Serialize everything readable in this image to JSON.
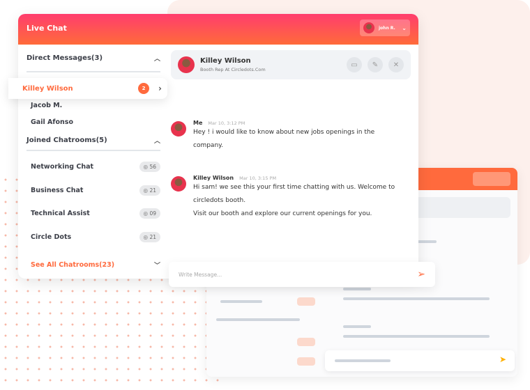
{
  "app": {
    "title": "Live Chat",
    "user": "john R."
  },
  "sidebar": {
    "direct_title": "Direct Messages(3)",
    "direct": [
      {
        "name": "Killey Wilson",
        "badge": "2"
      },
      {
        "name": "Jacob M."
      },
      {
        "name": "Gail Afonso"
      }
    ],
    "rooms_title": "Joined Chatrooms(5)",
    "rooms": [
      {
        "name": "Networking Chat",
        "count": "56"
      },
      {
        "name": "Business Chat",
        "count": "21"
      },
      {
        "name": "Technical Assist",
        "count": "09"
      },
      {
        "name": "Circle Dots",
        "count": "21"
      }
    ],
    "see_all": "See All Chatrooms(23)"
  },
  "chat": {
    "contact": {
      "name": "Killey Wilson",
      "subtitle": "Booth Rep At Circledots.Com"
    },
    "messages": [
      {
        "sender": "Me",
        "time": "Mar 10, 3:12 PM",
        "lines": [
          "Hey ! i would like to  know about new jobs openings in the",
          "company."
        ]
      },
      {
        "sender": "Killey Wilson",
        "time": "Mar 10, 3:15 PM",
        "lines": [
          "Hi sam! we see this your first time chatting with us. Welcome to",
          "circledots booth.",
          "Visit our booth and explore our current openings for you."
        ]
      }
    ],
    "input_placeholder": "Write Message..."
  },
  "colors": {
    "accent": "#ff6a3d",
    "header_start": "#ff3d6e"
  }
}
